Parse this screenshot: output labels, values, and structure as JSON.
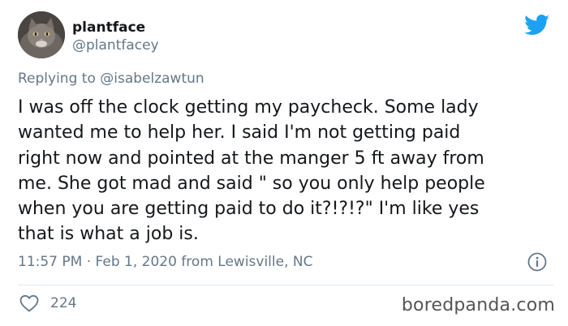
{
  "tweet": {
    "display_name": "plantface",
    "handle": "@plantfacey",
    "reply_prefix": "Replying to",
    "reply_to": "@isabelzawtun",
    "body_text": "I was off the clock getting my paycheck. Some lady\nwanted me to help her. I said I'm not getting paid\nright now and pointed at the manger 5 ft away from\nme. She got mad and said \" so you only help people\nwhen you are getting paid to do it?!?!?\" I'm like yes\nthat is what a job is.",
    "timestamp": "11:57 PM · Feb 1, 2020 from Lewisville, NC",
    "like_count": "224"
  },
  "icons": {
    "brand": "twitter-bird-icon",
    "info": "info-icon",
    "like": "heart-icon"
  },
  "watermark": "boredpanda.com",
  "colors": {
    "twitter_blue": "#1da1f2",
    "secondary_text": "#657786",
    "primary_text": "#14171a"
  }
}
